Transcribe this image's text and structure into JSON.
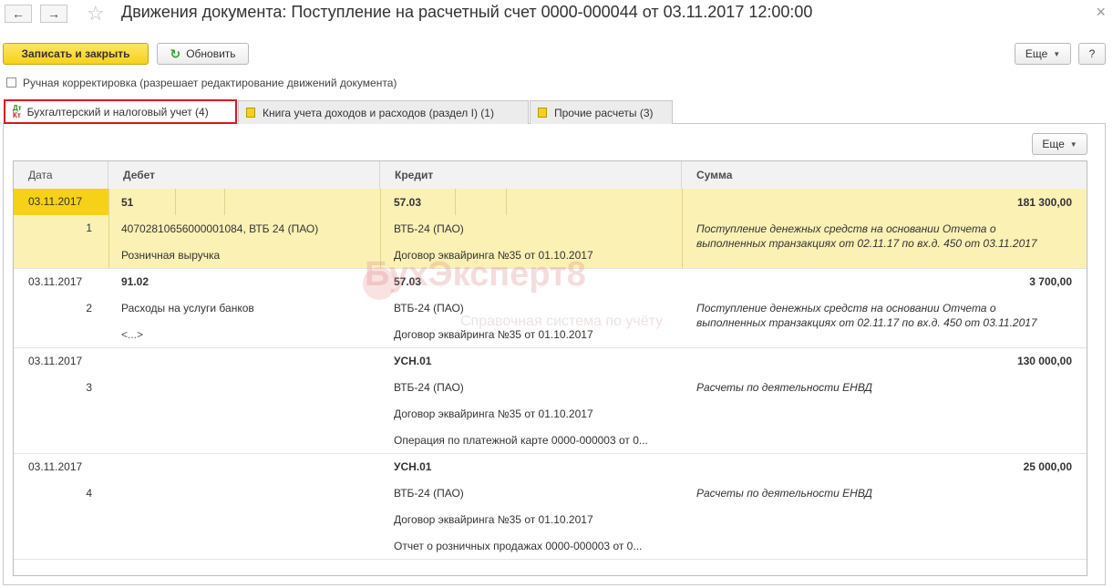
{
  "window": {
    "title": "Движения документа: Поступление на расчетный счет 0000-000044 от 03.11.2017 12:00:00"
  },
  "toolbar": {
    "save_close": "Записать и закрыть",
    "refresh": "Обновить",
    "more": "Еще",
    "help": "?"
  },
  "manual": {
    "label": "Ручная корректировка (разрешает редактирование движений документа)"
  },
  "tabs": [
    {
      "label": "Бухгалтерский и налоговый учет (4)"
    },
    {
      "label": "Книга учета доходов и расходов (раздел I) (1)"
    },
    {
      "label": "Прочие расчеты (3)"
    }
  ],
  "table_more": "Еще",
  "icon_labels": {
    "dt": "Дт",
    "kt": "Кт"
  },
  "watermark": {
    "brand": "БухЭксперт8",
    "tagline": "Справочная система по учёту"
  },
  "columns": [
    "Дата",
    "Дебет",
    "Кредит",
    "Сумма"
  ],
  "entries": [
    {
      "date": "03.11.2017",
      "num": "1",
      "debit": "51",
      "debit_sub1": "40702810656000001084, ВТБ 24 (ПАО)",
      "debit_sub2": "Розничная выручка",
      "credit": "57.03",
      "credit_sub1": "ВТБ-24 (ПАО)",
      "credit_sub2": "Договор эквайринга №35 от 01.10.2017",
      "amount": "181 300,00",
      "note1": "Поступление денежных средств на основании Отчета о",
      "note2": "выполненных транзакциях от 02.11.17 по вх.д. 450 от 03.11.2017"
    },
    {
      "date": "03.11.2017",
      "num": "2",
      "debit": "91.02",
      "debit_sub1": "Расходы на услуги банков",
      "debit_sub2": "<...>",
      "credit": "57.03",
      "credit_sub1": "ВТБ-24 (ПАО)",
      "credit_sub2": "Договор эквайринга №35 от 01.10.2017",
      "amount": "3 700,00",
      "note1": "Поступление денежных средств на основании Отчета о",
      "note2": "выполненных транзакциях от 02.11.17 по вх.д. 450 от 03.11.2017"
    },
    {
      "date": "03.11.2017",
      "num": "3",
      "credit": "УСН.01",
      "credit_sub1": "ВТБ-24 (ПАО)",
      "credit_sub2": "Договор эквайринга №35 от 01.10.2017",
      "credit_sub3": "Операция по платежной карте 0000-000003 от 0...",
      "amount": "130 000,00",
      "note1": "Расчеты по деятельности ЕНВД"
    },
    {
      "date": "03.11.2017",
      "num": "4",
      "credit": "УСН.01",
      "credit_sub1": "ВТБ-24 (ПАО)",
      "credit_sub2": "Договор эквайринга №35 от 01.10.2017",
      "credit_sub3": "Отчет о розничных продажах 0000-000003 от 0...",
      "amount": "25 000,00",
      "note1": "Расчеты по деятельности ЕНВД"
    }
  ]
}
